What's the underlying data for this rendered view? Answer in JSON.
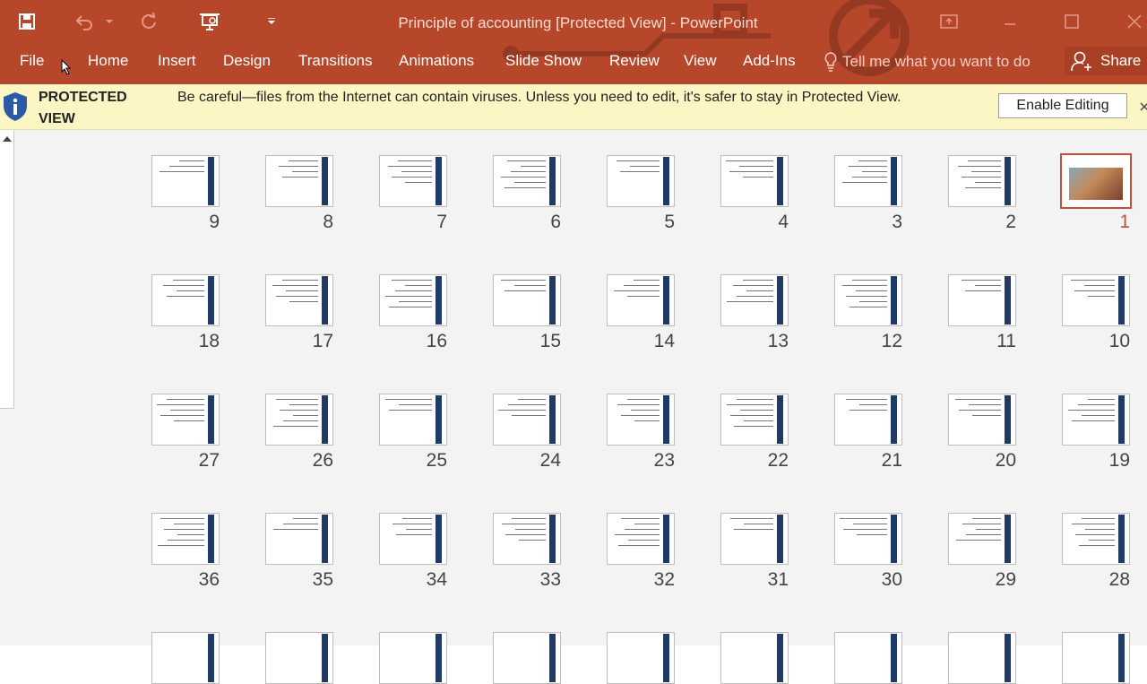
{
  "app": {
    "title": "Principle of accounting [Protected View] - PowerPoint"
  },
  "ribbon": {
    "tabs": [
      "File",
      "Home",
      "Insert",
      "Design",
      "Transitions",
      "Animations",
      "Slide Show",
      "Review",
      "View",
      "Add-Ins"
    ],
    "tell_me_placeholder": "Tell me what you want to do",
    "share_label": "Share"
  },
  "protected_view": {
    "label": "PROTECTED VIEW",
    "message": "Be careful—files from the Internet can contain viruses. Unless you need to edit, it's safer to stay in Protected View.",
    "button_label": "Enable Editing"
  },
  "slide_sorter": {
    "selected_slide": "1",
    "rows": [
      [
        "9",
        "8",
        "7",
        "6",
        "5",
        "4",
        "3",
        "2",
        "1"
      ],
      [
        "18",
        "17",
        "16",
        "15",
        "14",
        "13",
        "12",
        "11",
        "10"
      ],
      [
        "27",
        "26",
        "25",
        "24",
        "23",
        "22",
        "21",
        "20",
        "19"
      ],
      [
        "36",
        "35",
        "34",
        "33",
        "32",
        "31",
        "30",
        "29",
        "28"
      ]
    ]
  },
  "colors": {
    "title_bar": "#b7472a",
    "protected_bar": "#fcf6c4",
    "selection": "#c0503a",
    "slide_stripe": "#1f3a66"
  }
}
